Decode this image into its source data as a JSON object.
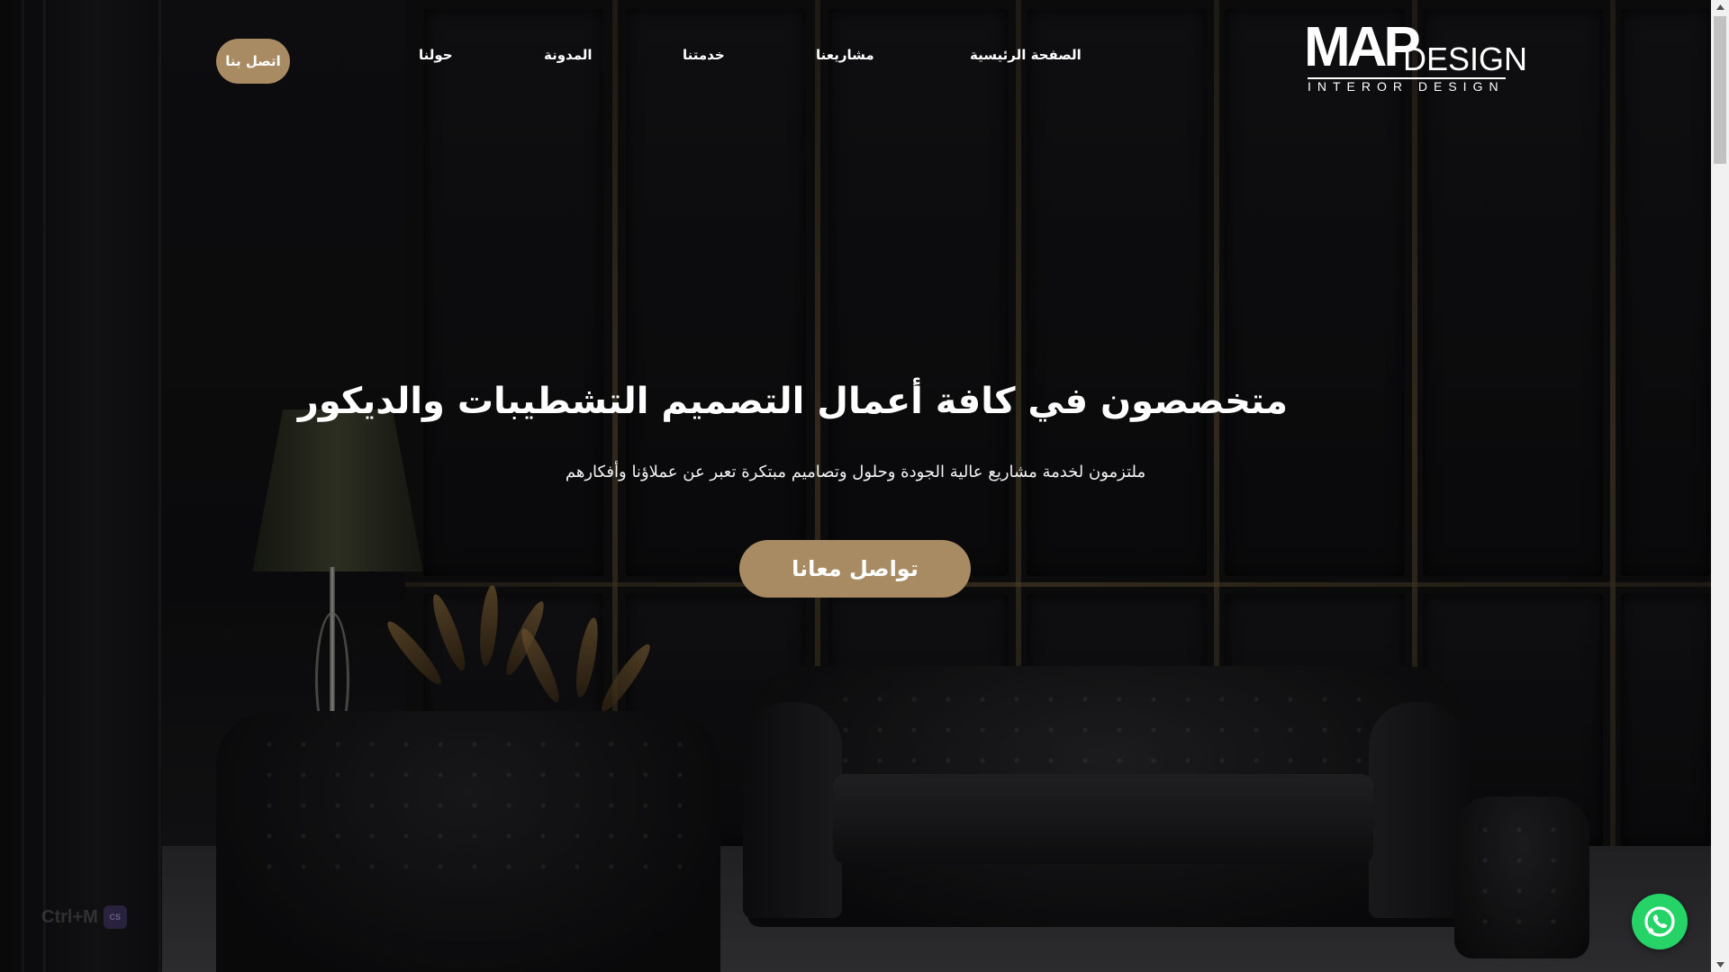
{
  "brand": {
    "logo_main": "MAP",
    "logo_design": "DESIGN",
    "logo_tagline": "INTEROR DESIGN"
  },
  "nav": {
    "items": [
      {
        "label": "الصفحة الرئيسية"
      },
      {
        "label": "مشاريعنا"
      },
      {
        "label": "خدمتنا"
      },
      {
        "label": "المدونة"
      },
      {
        "label": "حولنا"
      }
    ],
    "contact_button": "اتصل بنا"
  },
  "hero": {
    "title": "متخصصون في كافة أعمال التصميم التشطيبات والديكور",
    "subtitle": "ملتزمون لخدمة مشاريع عالية الجودة وحلول وتصاميم مبتكرة تعبر عن عملاؤنا وأفكارهم",
    "cta_label": "تواصل معانا"
  },
  "overlay": {
    "shortcut_text": "Ctrl+M",
    "shortcut_badge": "CS"
  },
  "colors": {
    "accent": "#a88a63",
    "whatsapp": "#25d366",
    "background": "#0b0b0c"
  },
  "icons": {
    "whatsapp": "whatsapp-icon",
    "scroll_up": "scroll-up-arrow-icon",
    "scroll_down": "scroll-down-arrow-icon"
  }
}
